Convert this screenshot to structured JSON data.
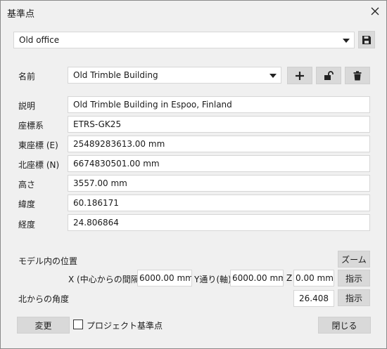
{
  "window": {
    "title": "基準点"
  },
  "profile": {
    "selected": "Old office"
  },
  "point": {
    "name_label": "名前",
    "name_value": "Old Trimble Building",
    "fields": [
      {
        "label": "説明",
        "value": "Old Trimble Building in Espoo, Finland"
      },
      {
        "label": "座標系",
        "value": "ETRS-GK25"
      },
      {
        "label": "東座標 (E)",
        "value": "25489283613.00 mm"
      },
      {
        "label": "北座標 (N)",
        "value": "6674830501.00 mm"
      },
      {
        "label": "高さ",
        "value": "3557.00 mm"
      },
      {
        "label": "緯度",
        "value": "60.186171"
      },
      {
        "label": "経度",
        "value": "24.806864"
      }
    ]
  },
  "position": {
    "title": "モデル内の位置",
    "zoom_label": "ズーム",
    "x_label": "X (中心からの間隔)",
    "x_value": "6000.00 mm",
    "y_label": "Y通り(軸)",
    "y_value": "6000.00 mm",
    "z_label": "Z",
    "z_value": "0.00 mm",
    "pick_label": "指示"
  },
  "north": {
    "label": "北からの角度",
    "value": "26.408",
    "pick_label": "指示"
  },
  "footer": {
    "change_label": "変更",
    "project_point_label": "プロジェクト基準点",
    "project_point_checked": false,
    "close_label": "閉じる"
  }
}
